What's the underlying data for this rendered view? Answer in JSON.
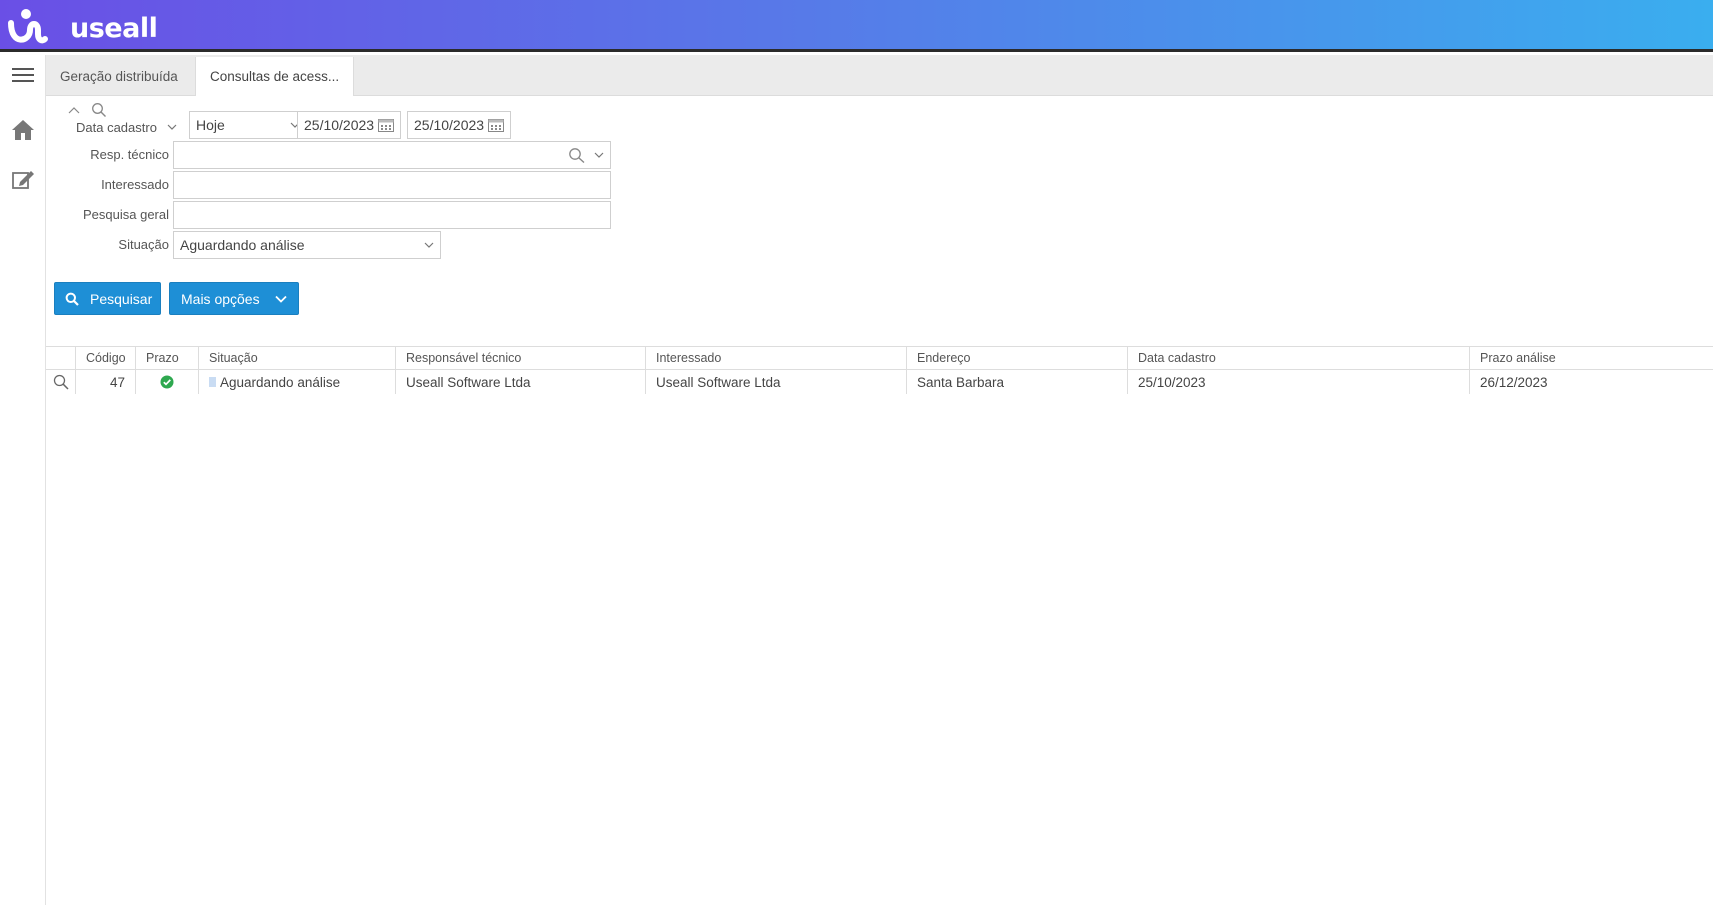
{
  "app": {
    "logo_text": "useall",
    "brand_colors": [
      "#6a4fe6",
      "#3aaeef"
    ]
  },
  "sidebar": {
    "items": [
      {
        "icon": "hamburger-menu-icon"
      },
      {
        "icon": "home-icon"
      },
      {
        "icon": "edit-icon"
      }
    ]
  },
  "tabs": [
    {
      "label": "Geração distribuída",
      "active": false
    },
    {
      "label": "Consultas de acess...",
      "active": true
    }
  ],
  "filters": {
    "data_cadastro": {
      "label": "Data cadastro",
      "period": "Hoje",
      "date_from": "25/10/2023",
      "date_to": "25/10/2023"
    },
    "resp_tecnico": {
      "label": "Resp. técnico",
      "value": ""
    },
    "interessado": {
      "label": "Interessado",
      "value": ""
    },
    "pesquisa_geral": {
      "label": "Pesquisa geral",
      "value": ""
    },
    "situacao": {
      "label": "Situação",
      "value": "Aguardando análise"
    }
  },
  "actions": {
    "search_label": "Pesquisar",
    "more_label": "Mais opções"
  },
  "table": {
    "columns": [
      "Código",
      "Prazo",
      "Situação",
      "Responsável técnico",
      "Interessado",
      "Endereço",
      "Data cadastro",
      "Prazo análise"
    ],
    "rows": [
      {
        "codigo": "47",
        "prazo_status": "ok",
        "situacao": "Aguardando análise",
        "responsavel": "Useall Software Ltda",
        "interessado": "Useall Software Ltda",
        "endereco": "Santa Barbara",
        "data_cadastro": "25/10/2023",
        "prazo_analise": "26/12/2023"
      }
    ],
    "status_colors": {
      "ok": "#2ea84f",
      "situacao_marker": "#c9dcf3"
    }
  }
}
